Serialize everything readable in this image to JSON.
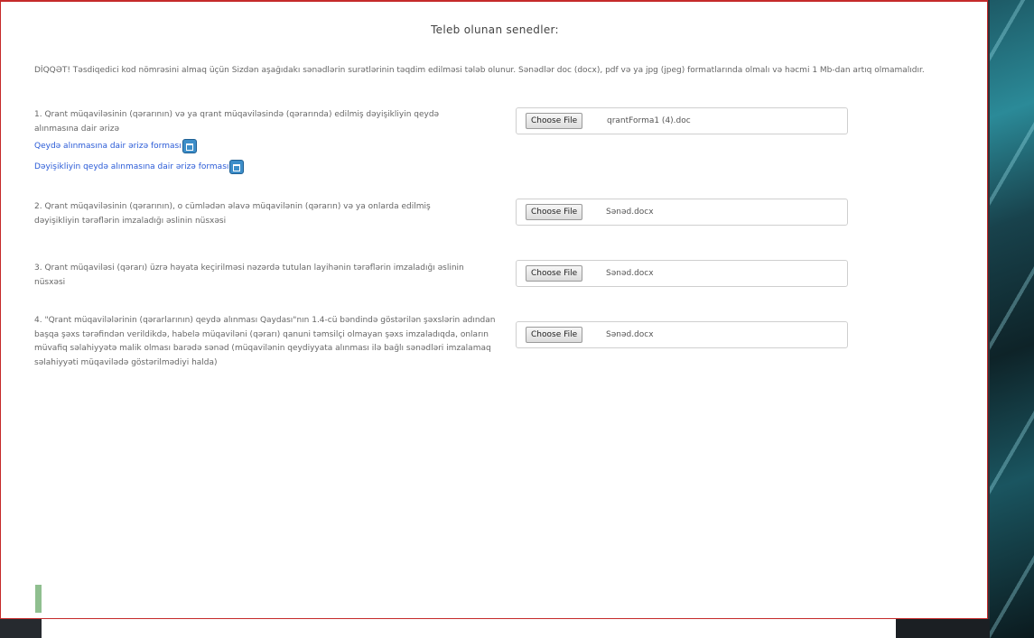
{
  "modal": {
    "title": "Teleb olunan senedler:",
    "warning": "DİQQƏT! Təsdiqedici kod nömrəsini almaq üçün Sizdən aşağıdakı sənədlərin surətlərinin təqdim edilməsi tələb olunur. Sənədlər doc (docx), pdf və ya jpg (jpeg) formatlarında olmalı və həcmi 1 Mb-dan artıq olmamalıdır."
  },
  "requirements": [
    {
      "text": "1. Qrant müqaviləsinin (qərarının) və ya qrant müqaviləsində (qərarında) edilmiş dəyişikliyin qeydə alınmasına dair ərizə",
      "links": [
        "Qeydə alınmasına dair ərizə forması",
        "Dəyişikliyin qeydə alınmasına dair ərizə forması"
      ],
      "button": "Choose File",
      "file": "qrantForma1 (4).doc"
    },
    {
      "text": "2. Qrant müqaviləsinin (qərarının), o cümlədən əlavə müqavilənin (qərarın) və ya onlarda edilmiş dəyişikliyin tərəflərin imzaladığı əslinin nüsxəsi",
      "button": "Choose File",
      "file": "Sənəd.docx"
    },
    {
      "text": "3. Qrant müqaviləsi (qərarı) üzrə həyata keçirilməsi nəzərdə tutulan layihənin tərəflərin imzaladığı əslinin nüsxəsi",
      "button": "Choose File",
      "file": "Sənəd.docx"
    },
    {
      "text": "4. \"Qrant müqavilələrinin (qərarlarının) qeydə alınması Qaydası\"nın 1.4-cü bəndində göstərilən şəxslərin adından başqa şəxs tərəfindən verildikdə, habelə müqaviləni (qərarı) qanuni təmsilçi olmayan şəxs imzaladıqda, onların müvafiq səlahiyyətə malik olması barədə sənəd (müqavilənin qeydiyyata alınması ilə bağlı sənədləri imzalamaq səlahiyyəti müqavilədə göstərilmədiyi halda)",
      "button": "Choose File",
      "file": "Sənəd.docx"
    }
  ]
}
